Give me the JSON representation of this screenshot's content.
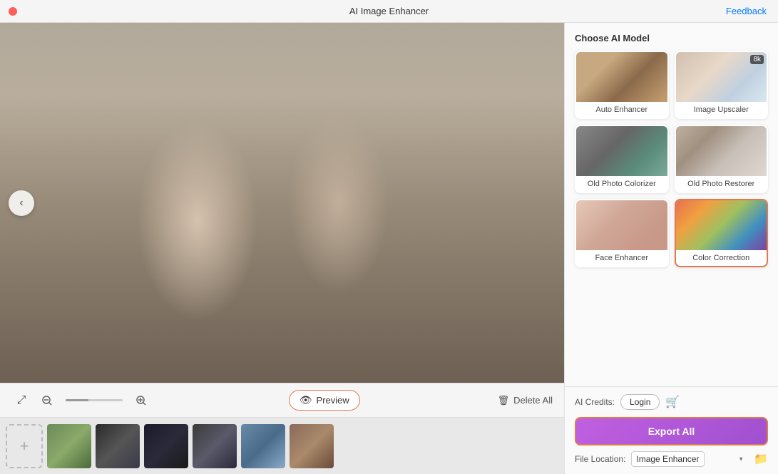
{
  "titleBar": {
    "title": "AI Image Enhancer",
    "feedbackLabel": "Feedback"
  },
  "toolbar": {
    "previewLabel": "Preview",
    "deleteAllLabel": "Delete All"
  },
  "rightPanel": {
    "sectionTitle": "Choose AI Model",
    "models": [
      {
        "id": "auto-enhancer",
        "label": "Auto Enhancer",
        "selected": false,
        "thumbClass": "model-auto"
      },
      {
        "id": "image-upscaler",
        "label": "Image Upscaler",
        "selected": false,
        "thumbClass": "model-upscaler"
      },
      {
        "id": "old-photo-colorizer",
        "label": "Old Photo Colorizer",
        "selected": false,
        "thumbClass": "model-colorizer"
      },
      {
        "id": "old-photo-restorer",
        "label": "Old Photo Restorer",
        "selected": false,
        "thumbClass": "model-old-restorer"
      },
      {
        "id": "face-enhancer",
        "label": "Face Enhancer",
        "selected": false,
        "thumbClass": "model-face"
      },
      {
        "id": "color-correction",
        "label": "Color Correction",
        "selected": true,
        "thumbClass": "model-color-correction"
      }
    ]
  },
  "bottomBar": {
    "aiCreditsLabel": "AI Credits:",
    "loginLabel": "Login",
    "exportLabel": "Export All",
    "fileLocationLabel": "File Location:",
    "fileLocationValue": "Image Enhancer"
  },
  "filmstrip": {
    "addLabel": "+"
  }
}
